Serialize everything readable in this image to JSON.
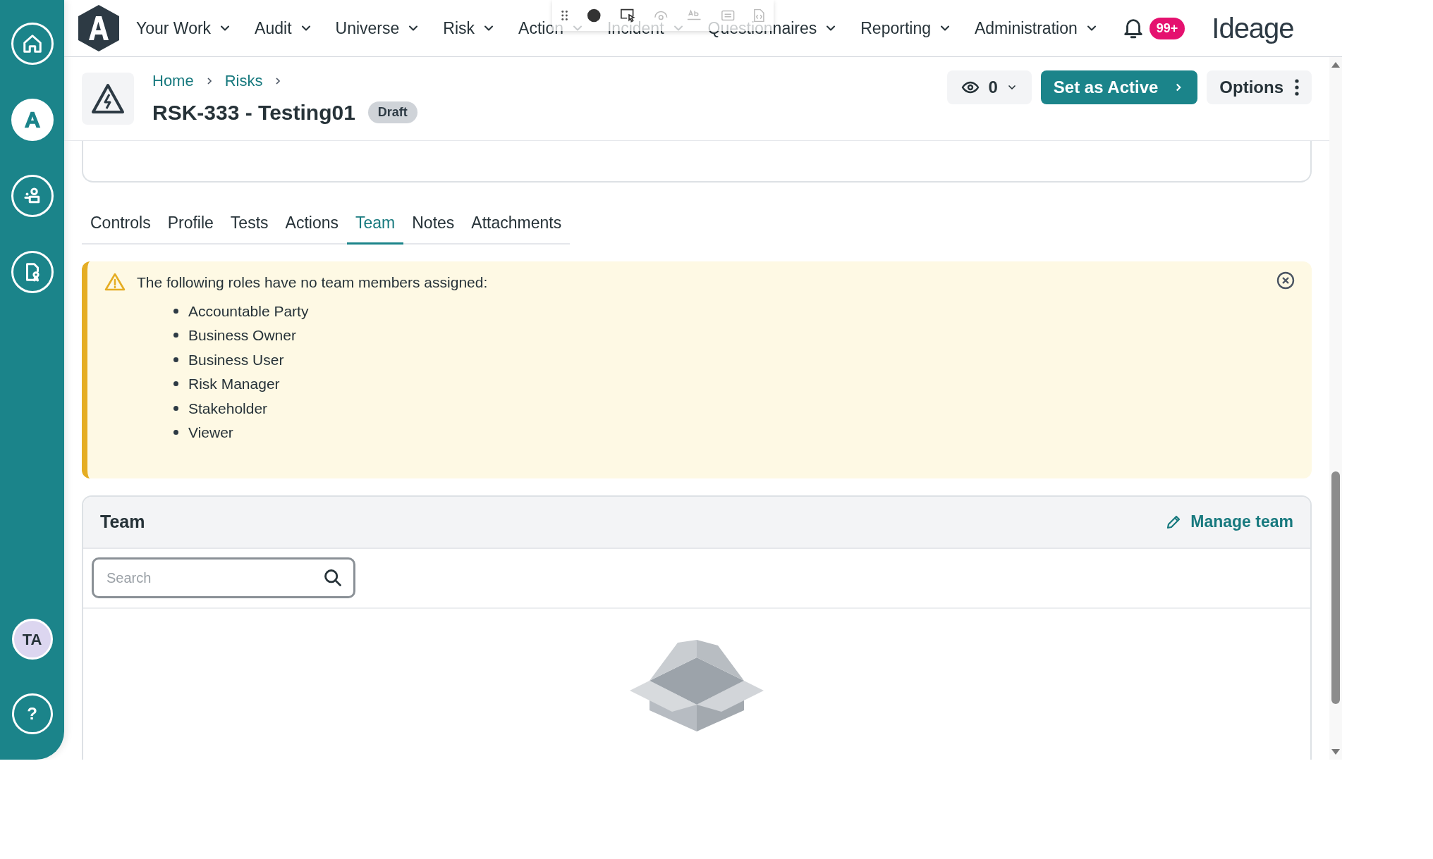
{
  "sidebar": {
    "items": [
      {
        "kind": "home",
        "selected": false
      },
      {
        "kind": "app",
        "selected": true
      },
      {
        "kind": "people",
        "selected": false
      },
      {
        "kind": "document",
        "selected": false
      }
    ],
    "avatar": "TA",
    "help": "?"
  },
  "nav": {
    "items": [
      {
        "label": "Your Work"
      },
      {
        "label": "Audit"
      },
      {
        "label": "Universe"
      },
      {
        "label": "Risk"
      },
      {
        "label": "Action"
      },
      {
        "label": "Incident"
      },
      {
        "label": "Questionnaires"
      },
      {
        "label": "Reporting"
      },
      {
        "label": "Administration"
      }
    ],
    "notification_badge": "99+",
    "brand": "Ideage"
  },
  "header": {
    "breadcrumbs": [
      "Home",
      "Risks"
    ],
    "title": "RSK-333 - Testing01",
    "status": "Draft",
    "watchers": "0",
    "primary_action": "Set as Active",
    "options": "Options"
  },
  "tabs": [
    {
      "label": "Controls",
      "selected": false
    },
    {
      "label": "Profile",
      "selected": false
    },
    {
      "label": "Tests",
      "selected": false
    },
    {
      "label": "Actions",
      "selected": false
    },
    {
      "label": "Team",
      "selected": true
    },
    {
      "label": "Notes",
      "selected": false
    },
    {
      "label": "Attachments",
      "selected": false
    }
  ],
  "alert": {
    "message": "The following roles have no team members assigned:",
    "roles": [
      "Accountable Party",
      "Business Owner",
      "Business User",
      "Risk Manager",
      "Stakeholder",
      "Viewer"
    ]
  },
  "team_panel": {
    "title": "Team",
    "manage": "Manage team",
    "search": {
      "placeholder": "Search"
    }
  }
}
